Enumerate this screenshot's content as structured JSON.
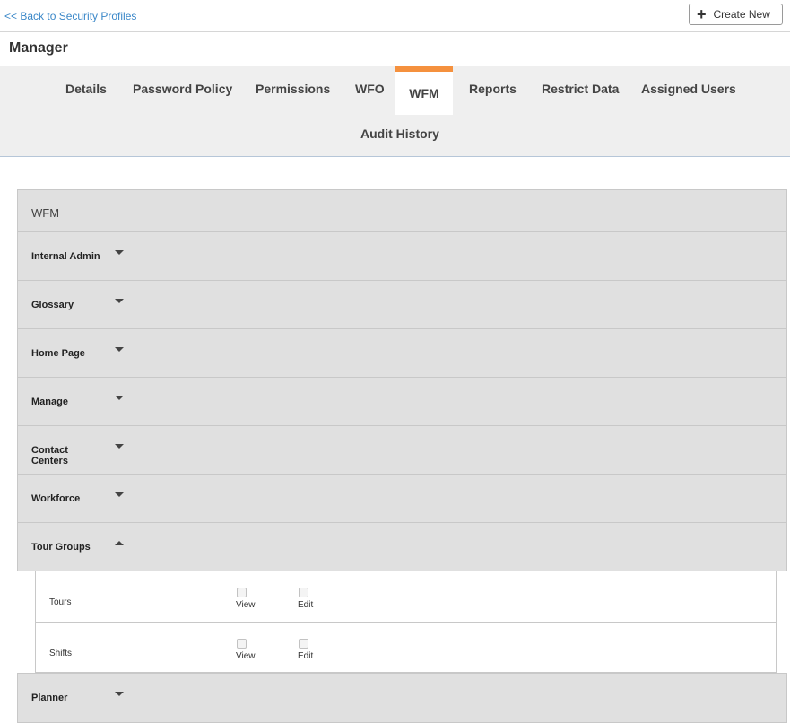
{
  "header": {
    "back_link": "<< Back to Security Profiles",
    "create_new_label": "Create New",
    "plus_icon": "+"
  },
  "profile": {
    "title": "Manager"
  },
  "tabs": [
    {
      "label": "Details"
    },
    {
      "label": "Password Policy"
    },
    {
      "label": "Permissions"
    },
    {
      "label": "WFO"
    },
    {
      "label": "WFM",
      "active": true
    },
    {
      "label": "Reports"
    },
    {
      "label": "Restrict Data"
    },
    {
      "label": "Assigned Users"
    },
    {
      "label": "Audit History"
    }
  ],
  "section": {
    "title": "WFM",
    "groups": [
      {
        "label": "Internal Admin"
      },
      {
        "label": "Glossary"
      },
      {
        "label": "Home Page"
      },
      {
        "label": "Manage"
      },
      {
        "label": "Contact Centers"
      },
      {
        "label": "Workforce"
      },
      {
        "label": "Tour Groups",
        "expanded": true,
        "permissions": [
          {
            "name": "Tours",
            "view_label": "View",
            "edit_label": "Edit",
            "view_checked": false,
            "edit_checked": false
          },
          {
            "name": "Shifts",
            "view_label": "View",
            "edit_label": "Edit",
            "view_checked": false,
            "edit_checked": false
          }
        ]
      },
      {
        "label": "Planner"
      }
    ]
  },
  "colors": {
    "link": "#3a87c8",
    "active_tab_accent": "#f5913e",
    "panel_bg": "#e0e0e0",
    "tab_bar_bg": "#efefef"
  }
}
